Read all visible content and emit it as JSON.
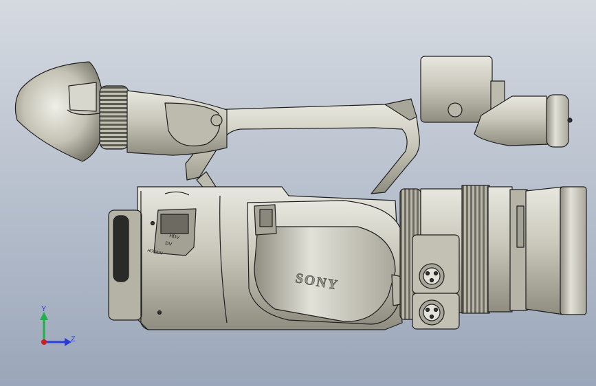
{
  "viewport": {
    "background_top": "#d5dae1",
    "background_bottom": "#9aa6b9",
    "part_fill": "#c9c7ba",
    "part_fill_light": "#e4e3da",
    "part_fill_dark": "#8f8d80",
    "edge_color": "#1e1e1e"
  },
  "model": {
    "brand_text": "SONY",
    "switch_label_1": "HDV",
    "switch_label_2": "DV",
    "switch_label_3": "HDV/DV"
  },
  "triad": {
    "y_label": "Y",
    "z_label": "Z",
    "y_color": "#22b04a",
    "z_color": "#2a3bd6",
    "x_color": "#d11d1d",
    "icon": "coordinate-triad-icon"
  }
}
